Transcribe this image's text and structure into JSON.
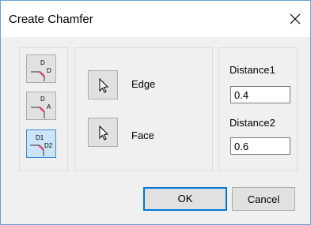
{
  "window": {
    "title": "Create Chamfer"
  },
  "modes": [
    {
      "name": "distance-distance",
      "top_label": "D",
      "side_label": "D"
    },
    {
      "name": "distance-angle",
      "top_label": "D",
      "side_label": "A"
    },
    {
      "name": "two-distances",
      "top_label": "D1",
      "side_label": "D2",
      "selected": true
    }
  ],
  "selection": {
    "edge_label": "Edge",
    "face_label": "Face"
  },
  "distances": {
    "distance1_label": "Distance1",
    "distance1_value": "0.4",
    "distance2_label": "Distance2",
    "distance2_value": "0.6"
  },
  "buttons": {
    "ok_label": "OK",
    "cancel_label": "Cancel"
  },
  "colors": {
    "accent": "#0078d7",
    "chamfer_marker": "#e0407a",
    "selected_bg": "#cce4f7"
  }
}
